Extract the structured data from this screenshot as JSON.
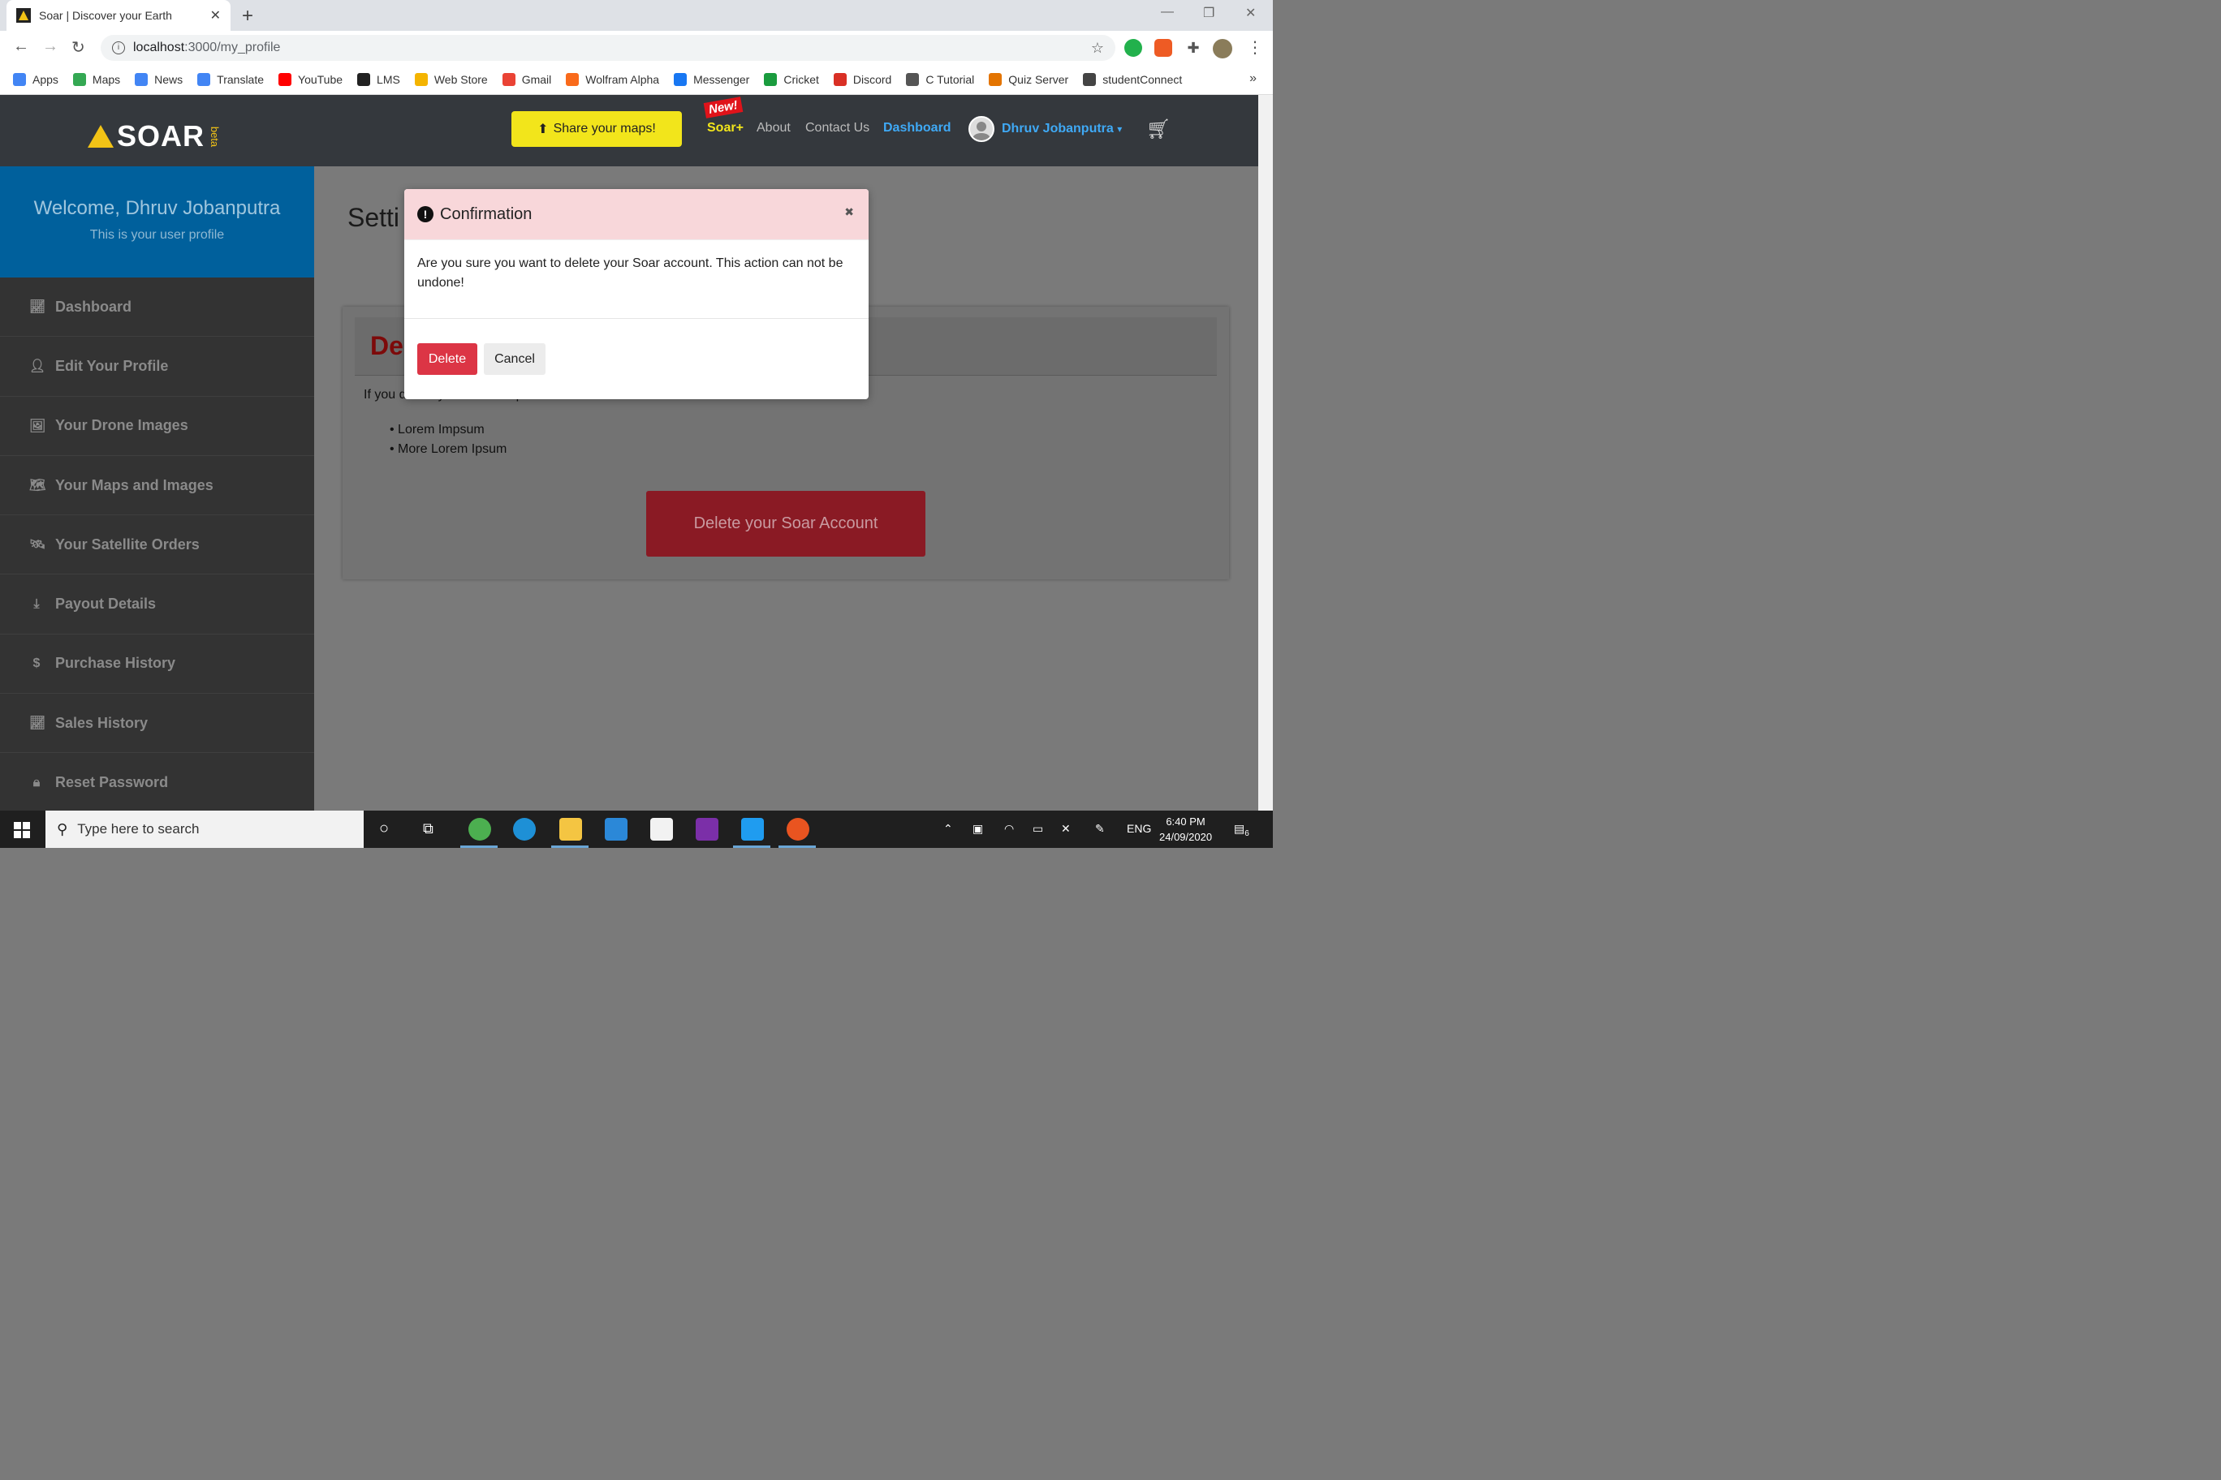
{
  "browser": {
    "tab_title": "Soar | Discover your Earth",
    "tab_close": "✕",
    "new_tab": "+",
    "url_host": "localhost",
    "url_path": ":3000/my_profile",
    "bookmarks": [
      {
        "label": "Apps",
        "color": "#4285f4"
      },
      {
        "label": "Maps",
        "color": "#34a853"
      },
      {
        "label": "News",
        "color": "#4285f4"
      },
      {
        "label": "Translate",
        "color": "#4285f4"
      },
      {
        "label": "YouTube",
        "color": "#ff0000"
      },
      {
        "label": "LMS",
        "color": "#222222"
      },
      {
        "label": "Web Store",
        "color": "#f4b400"
      },
      {
        "label": "Gmail",
        "color": "#ea4335"
      },
      {
        "label": "Wolfram Alpha",
        "color": "#f96a1b"
      },
      {
        "label": "Messenger",
        "color": "#1877f2"
      },
      {
        "label": "Cricket",
        "color": "#1a9c3e"
      },
      {
        "label": "Discord",
        "color": "#d93025"
      },
      {
        "label": "C Tutorial",
        "color": "#555555"
      },
      {
        "label": "Quiz Server",
        "color": "#e37400"
      },
      {
        "label": "studentConnect",
        "color": "#444444"
      }
    ],
    "bookmarks_more": "»"
  },
  "header": {
    "logo_text": "SOAR",
    "logo_beta": "beta",
    "share_button": "Share your maps!",
    "new_badge": "New!",
    "soar_plus": "Soar+",
    "about": "About",
    "contact": "Contact Us",
    "dashboard": "Dashboard",
    "user_name": "Dhruv Jobanputra",
    "accent_yellow": "#f2e51b",
    "accent_blue": "#3fa9f5"
  },
  "sidebar": {
    "welcome_title": "Welcome, Dhruv Jobanputra",
    "welcome_subtitle": "This is your user profile",
    "items": [
      {
        "label": "Dashboard",
        "icon": "chart-icon"
      },
      {
        "label": "Edit Your Profile",
        "icon": "user-icon"
      },
      {
        "label": "Your Drone Images",
        "icon": "image-icon"
      },
      {
        "label": "Your Maps and Images",
        "icon": "map-icon"
      },
      {
        "label": "Your Satellite Orders",
        "icon": "satellite-icon"
      },
      {
        "label": "Payout Details",
        "icon": "payout-icon"
      },
      {
        "label": "Purchase History",
        "icon": "dollar-icon"
      },
      {
        "label": "Sales History",
        "icon": "chart-icon"
      },
      {
        "label": "Reset Password",
        "icon": "lock-icon"
      }
    ]
  },
  "main": {
    "title": "Setti",
    "card_title": "De",
    "card_text": "If you delete your account please have these in mind:",
    "list": [
      "Lorem Impsum",
      "More Lorem Ipsum"
    ],
    "delete_account_button": "Delete your Soar Account"
  },
  "modal": {
    "title": "Confirmation",
    "body": "Are you sure you want to delete your Soar account. This action can not be undone!",
    "delete_button": "Delete",
    "cancel_button": "Cancel"
  },
  "taskbar": {
    "search_placeholder": "Type here to search",
    "language": "ENG",
    "time": "6:40 PM",
    "date": "24/09/2020",
    "notifications": "6"
  }
}
